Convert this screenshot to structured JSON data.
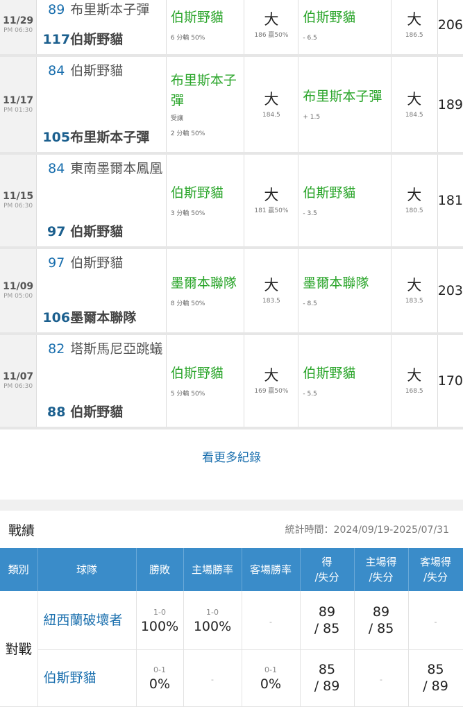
{
  "games": [
    {
      "date": "11/29",
      "time": "PM 06:30",
      "away_score": "89",
      "away_team": "布里斯本子彈",
      "home_score": "117",
      "home_team": "伯斯野貓",
      "spread_pick": "伯斯野貓",
      "spread_note": "",
      "spread_result": "6 分輸 50%",
      "ou1": "大",
      "ou1_sub": "186  贏50%",
      "spread2_pick": "伯斯野貓",
      "spread2_line": "- 6.5",
      "ou2": "大",
      "ou2_sub": "186.5",
      "total": "206"
    },
    {
      "date": "11/17",
      "time": "PM 01:30",
      "away_score": "84",
      "away_team": "伯斯野貓",
      "home_score": "105",
      "home_team": "布里斯本子彈",
      "spread_pick": "布里斯本子彈",
      "spread_note": "受讓",
      "spread_result": "2 分輸 50%",
      "ou1": "大",
      "ou1_sub": "184.5",
      "spread2_pick": "布里斯本子彈",
      "spread2_line": "+ 1.5",
      "ou2": "大",
      "ou2_sub": "184.5",
      "total": "189"
    },
    {
      "date": "11/15",
      "time": "PM 06:30",
      "away_score": "84",
      "away_team": "東南墨爾本鳳凰",
      "home_score": "97",
      "home_team": "伯斯野貓",
      "spread_pick": "伯斯野貓",
      "spread_note": "",
      "spread_result": "3 分輸 50%",
      "ou1": "大",
      "ou1_sub": "181  贏50%",
      "spread2_pick": "伯斯野貓",
      "spread2_line": "- 3.5",
      "ou2": "大",
      "ou2_sub": "180.5",
      "total": "181"
    },
    {
      "date": "11/09",
      "time": "PM 05:00",
      "away_score": "97",
      "away_team": "伯斯野貓",
      "home_score": "106",
      "home_team": "墨爾本聯隊",
      "spread_pick": "墨爾本聯隊",
      "spread_note": "",
      "spread_result": "8 分輸 50%",
      "ou1": "大",
      "ou1_sub": "183.5",
      "spread2_pick": "墨爾本聯隊",
      "spread2_line": "- 8.5",
      "ou2": "大",
      "ou2_sub": "183.5",
      "total": "203"
    },
    {
      "date": "11/07",
      "time": "PM 06:30",
      "away_score": "82",
      "away_team": "塔斯馬尼亞跳蟻",
      "home_score": "88",
      "home_team": "伯斯野貓",
      "spread_pick": "伯斯野貓",
      "spread_note": "",
      "spread_result": "5 分輸 50%",
      "ou1": "大",
      "ou1_sub": "169  贏50%",
      "spread2_pick": "伯斯野貓",
      "spread2_line": "- 5.5",
      "ou2": "大",
      "ou2_sub": "168.5",
      "total": "170"
    }
  ],
  "more_link": "看更多紀錄",
  "stats": {
    "title": "戰績",
    "time": "統計時間：2024/09/19-2025/07/31",
    "headers": [
      "類別",
      "球隊",
      "勝敗",
      "主場勝率",
      "客場勝率",
      "得\n/失分",
      "主場得\n/失分",
      "客場得\n/失分"
    ],
    "category": "對戰",
    "rows": [
      {
        "team": "紐西蘭破壞者",
        "wl": "1-0",
        "wl_pct": "100%",
        "home_wl": "1-0",
        "home_pct": "100%",
        "away_wl": "",
        "away_pct": "-",
        "pts": "89",
        "pts_against": "/ 85",
        "home_pts": "89",
        "home_against": "/ 85",
        "away_pts": "",
        "away_against": "-"
      },
      {
        "team": "伯斯野貓",
        "wl": "0-1",
        "wl_pct": "0%",
        "home_wl": "",
        "home_pct": "-",
        "away_wl": "0-1",
        "away_pct": "0%",
        "pts": "85",
        "pts_against": "/ 89",
        "home_pts": "",
        "home_against": "-",
        "away_pts": "85",
        "away_against": "/ 89"
      }
    ]
  }
}
